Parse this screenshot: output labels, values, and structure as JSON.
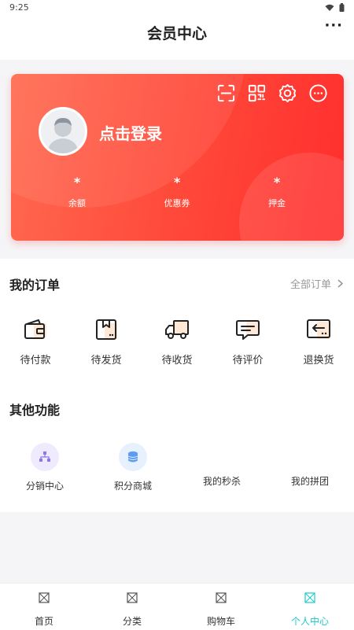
{
  "status_bar": {
    "time": "9:25"
  },
  "header": {
    "title": "会员中心",
    "more": "···"
  },
  "card": {
    "login_text": "点击登录",
    "stats": [
      {
        "value": "*",
        "label": "余额"
      },
      {
        "value": "*",
        "label": "优惠券"
      },
      {
        "value": "*",
        "label": "押金"
      }
    ]
  },
  "orders": {
    "title": "我的订单",
    "all_orders": "全部订单",
    "items": [
      {
        "label": "待付款",
        "icon": "wallet-icon"
      },
      {
        "label": "待发货",
        "icon": "package-icon"
      },
      {
        "label": "待收货",
        "icon": "truck-icon"
      },
      {
        "label": "待评价",
        "icon": "comment-icon"
      },
      {
        "label": "退换货",
        "icon": "return-icon"
      }
    ]
  },
  "others": {
    "title": "其他功能",
    "items": [
      {
        "label": "分销中心",
        "icon": "network-icon"
      },
      {
        "label": "积分商城",
        "icon": "coins-icon"
      },
      {
        "label": "我的秒杀",
        "icon": ""
      },
      {
        "label": "我的拼团",
        "icon": ""
      }
    ]
  },
  "tabbar": {
    "items": [
      {
        "label": "首页"
      },
      {
        "label": "分类"
      },
      {
        "label": "购物车"
      },
      {
        "label": "个人中心"
      }
    ]
  },
  "colors": {
    "accent": "#1ec8c8",
    "card_start": "#ff6a50",
    "card_end": "#ff2e2e"
  }
}
